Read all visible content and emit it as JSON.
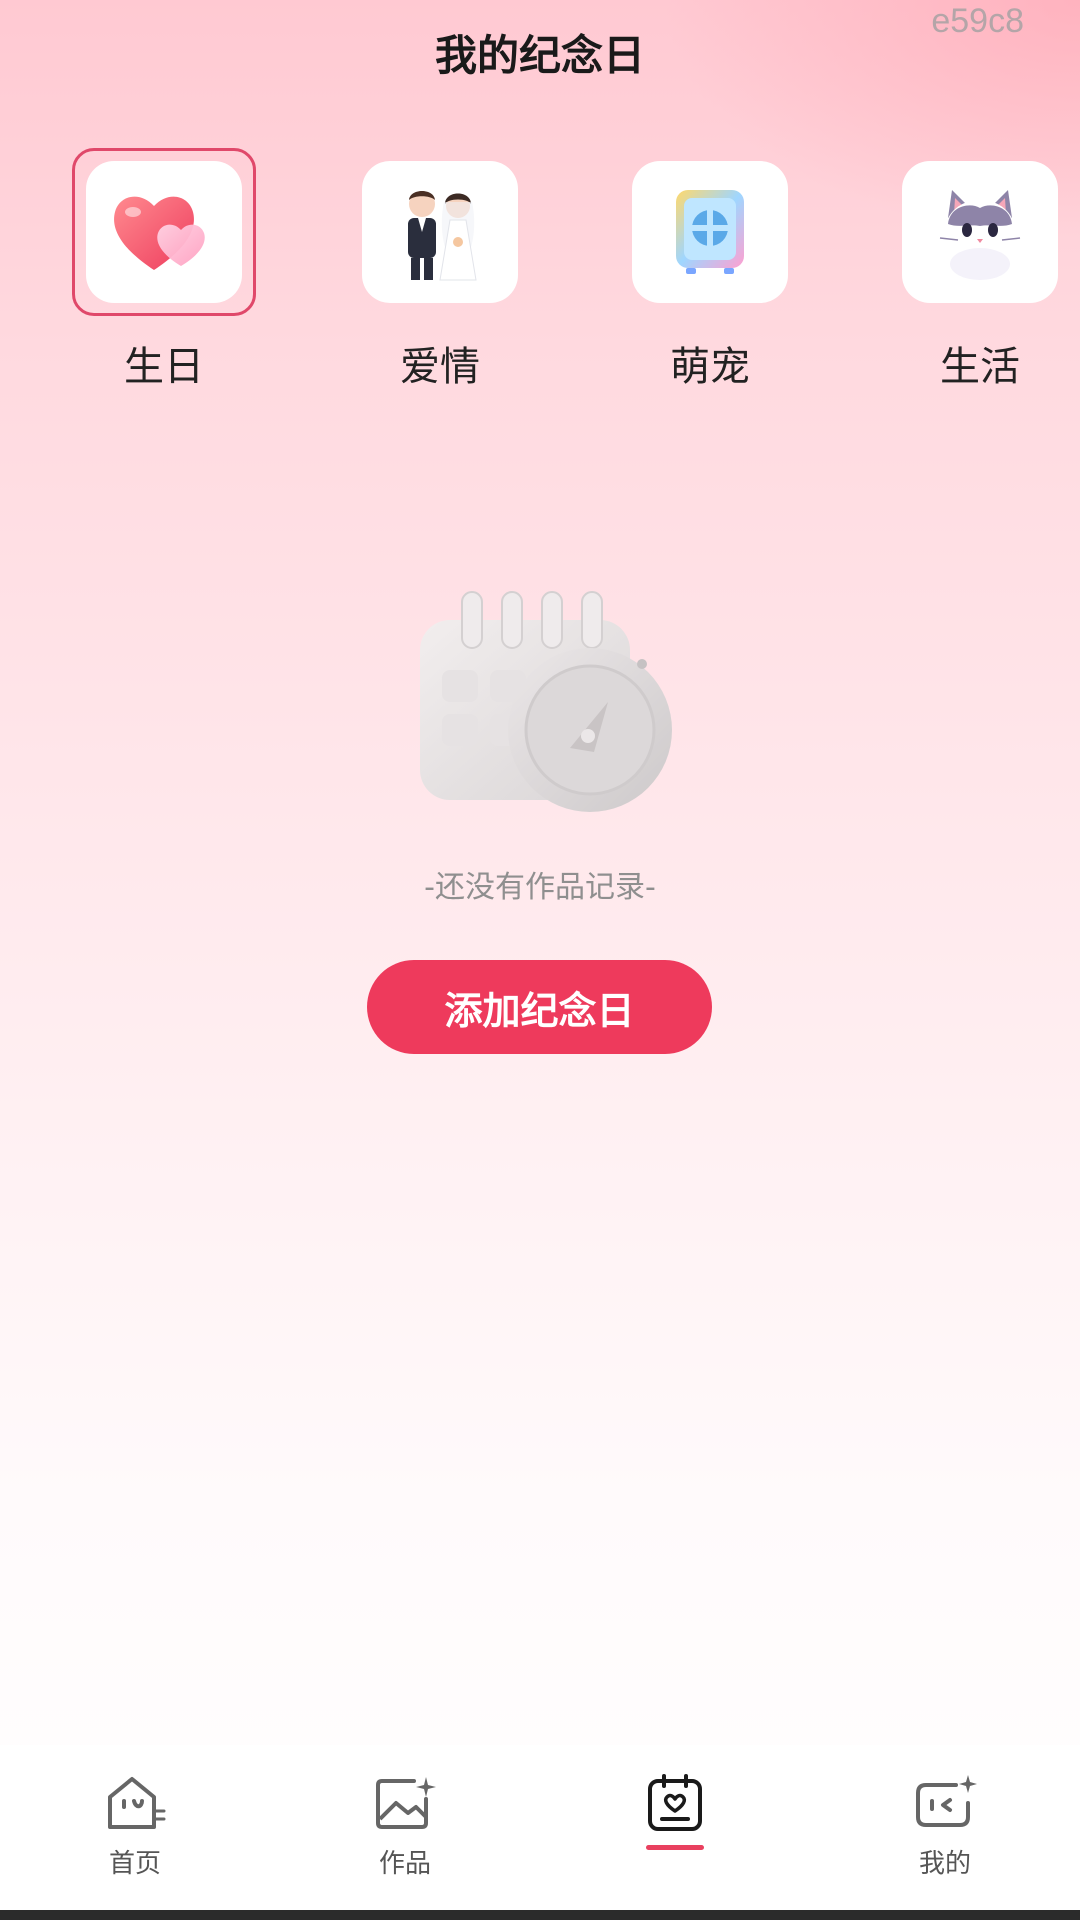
{
  "header": {
    "title": "我的纪念日",
    "corner_tag": "e59c8"
  },
  "categories": [
    {
      "label": "生日",
      "icon": "heart-icon",
      "selected": true
    },
    {
      "label": "爱情",
      "icon": "couple-icon",
      "selected": false
    },
    {
      "label": "萌宠",
      "icon": "pet-cabinet-icon",
      "selected": false
    },
    {
      "label": "生活",
      "icon": "cat-icon",
      "selected": false
    }
  ],
  "empty_state": {
    "icon": "calendar-clock-icon",
    "text": "-还没有作品记录-"
  },
  "add_button": {
    "label": "添加纪念日"
  },
  "tabbar": {
    "tabs": [
      {
        "label": "首页",
        "icon": "home-face-icon"
      },
      {
        "label": "作品",
        "icon": "image-sparkle-icon"
      },
      {
        "label": "",
        "icon": "anniversary-heart-icon",
        "active": true
      },
      {
        "label": "我的",
        "icon": "profile-face-icon"
      }
    ]
  },
  "colors": {
    "accent": "#ee3a5c",
    "selected_border": "#e0486a"
  }
}
